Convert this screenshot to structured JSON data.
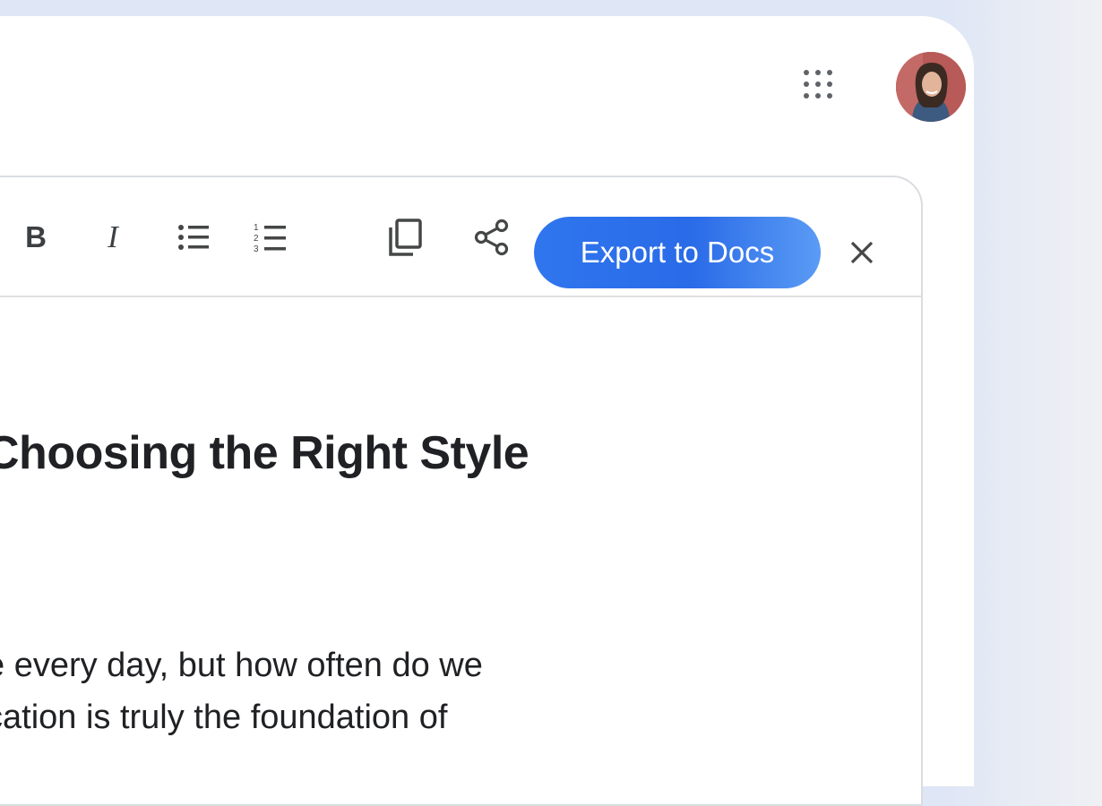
{
  "header": {
    "apps_icon": "apps-grid-icon",
    "avatar_icon": "user-avatar"
  },
  "toolbar": {
    "bold_label": "B",
    "italic_label": "I",
    "bullets_icon": "bulleted-list-icon",
    "numbers_icon": "numbered-list-icon",
    "copy_icon": "copy-icon",
    "share_icon": "share-icon",
    "export_label": "Export to Docs",
    "close_label": "×"
  },
  "document": {
    "title": "Choosing the Right Style",
    "body_lines": [
      "e every day, but how often do we",
      "cation is truly the foundation of"
    ]
  },
  "colors": {
    "accent": "#2f76ee",
    "background": "#dfe6f5",
    "text": "#202124",
    "icon": "#5f6368"
  }
}
